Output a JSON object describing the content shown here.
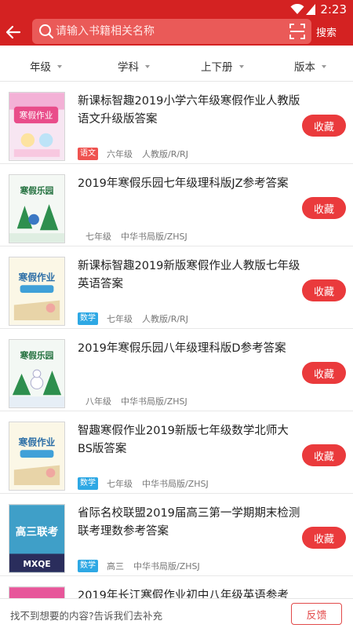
{
  "status": {
    "time": "2:23"
  },
  "search": {
    "placeholder": "请输入书籍相关名称",
    "button": "搜索"
  },
  "filters": [
    {
      "label": "年级"
    },
    {
      "label": "学科"
    },
    {
      "label": "上下册"
    },
    {
      "label": "版本"
    }
  ],
  "items": [
    {
      "title": "新课标智趣2019小学六年级寒假作业人教版语文升级版答案",
      "subject": "语文",
      "grade": "六年级",
      "publisher": "人教版/R/RJ",
      "fav": "收藏",
      "cover_text": "寒假作业"
    },
    {
      "title": "2019年寒假乐园七年级理科版JZ参考答案",
      "subject": "",
      "grade": "七年级",
      "publisher": "中华书局版/ZHSJ",
      "fav": "收藏",
      "cover_text": "寒假乐园"
    },
    {
      "title": "新课标智趣2019新版寒假作业人教版七年级英语答案",
      "subject": "数学",
      "grade": "七年级",
      "publisher": "人教版/R/RJ",
      "fav": "收藏",
      "cover_text": "寒假作业"
    },
    {
      "title": "2019年寒假乐园八年级理科版D参考答案",
      "subject": "",
      "grade": "八年级",
      "publisher": "中华书局版/ZHSJ",
      "fav": "收藏",
      "cover_text": "寒假乐园"
    },
    {
      "title": "智趣寒假作业2019新版七年级数学北师大BS版答案",
      "subject": "数学",
      "grade": "七年级",
      "publisher": "中华书局版/ZHSJ",
      "fav": "收藏",
      "cover_text": "寒假作业"
    },
    {
      "title": "省际名校联盟2019届高三第一学期期末检测联考理数参考答案",
      "subject": "数学",
      "grade": "高三",
      "publisher": "中华书局版/ZHSJ",
      "fav": "收藏",
      "cover_text": "高三联考",
      "cover_text2": "MXQE"
    },
    {
      "title": "2019年长江寒假作业初中八年级英语参考",
      "subject": "",
      "grade": "",
      "publisher": "",
      "fav": "",
      "cover_text": ""
    }
  ],
  "bottom": {
    "text": "找不到想要的内容?告诉我们去补充",
    "feedback": "反馈"
  },
  "colors": {
    "header": "#d42222",
    "fav": "#ea3a3c",
    "tag_red": "#ef5350",
    "tag_blue": "#2ea8e4"
  }
}
